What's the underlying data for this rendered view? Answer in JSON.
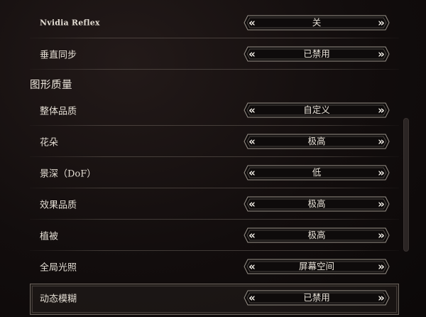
{
  "display_rows": [
    {
      "label": "Nvidia Reflex",
      "value": "关"
    },
    {
      "label": "垂直同步",
      "value": "已禁用"
    }
  ],
  "graphics_quality": {
    "section_title": "图形质量",
    "rows": [
      {
        "label": "整体品质",
        "value": "自定义"
      },
      {
        "label": "花朵",
        "value": "极高"
      },
      {
        "label": "景深（DoF）",
        "value": "低"
      },
      {
        "label": "效果品质",
        "value": "极高"
      },
      {
        "label": "植被",
        "value": "极高"
      },
      {
        "label": "全局光照",
        "value": "屏幕空间"
      },
      {
        "label": "动态模糊",
        "value": "已禁用"
      }
    ]
  },
  "arrows": {
    "previous": "«",
    "next": "»"
  },
  "colors": {
    "background": "#120d0d",
    "text": "#e3ddd3",
    "selector_border": "#8a847c",
    "highlight_border": "#6d655e"
  },
  "highlighted_setting": "动态模糊"
}
